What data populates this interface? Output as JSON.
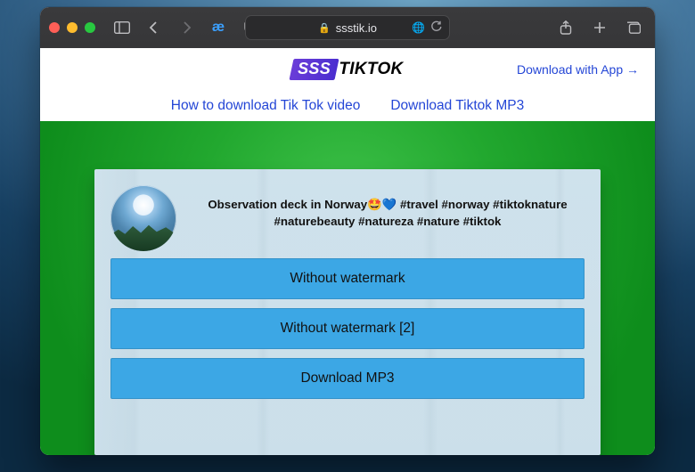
{
  "browser": {
    "url_host": "ssstik.io"
  },
  "topbar": {
    "brand_badge": "SSS",
    "brand_text": "TIKTOK",
    "download_app": "Download with App →"
  },
  "navlinks": {
    "howto": "How to download Tik Tok video",
    "mp3": "Download Tiktok MP3"
  },
  "card": {
    "title": "Observation deck in Norway🤩💙 #travel #norway #tiktoknature #naturebeauty #natureza #nature #tiktok",
    "buttons": [
      "Without watermark",
      "Without watermark [2]",
      "Download MP3"
    ]
  }
}
